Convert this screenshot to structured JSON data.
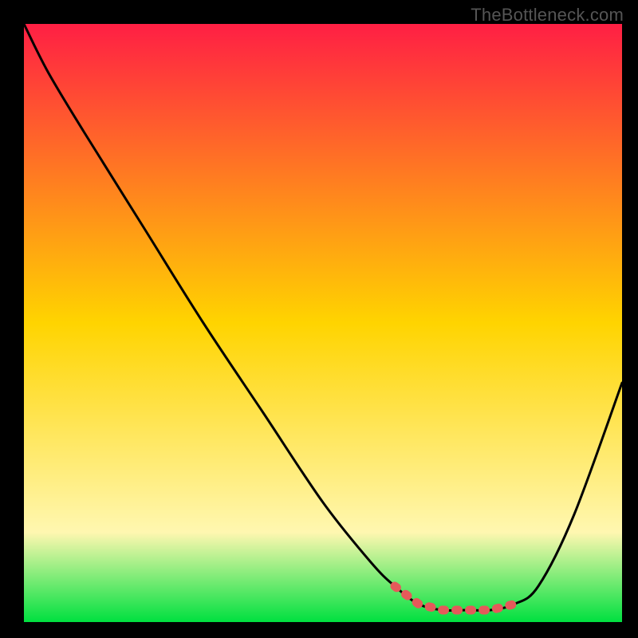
{
  "watermark": "TheBottleneck.com",
  "colors": {
    "grad_top": "#ff1f44",
    "grad_mid": "#ffd400",
    "grad_low": "#fff7b0",
    "grad_bottom": "#00e040",
    "curve": "#000000",
    "marker": "#e55a5a",
    "frame": "#000000"
  },
  "chart_data": {
    "type": "line",
    "title": "",
    "xlabel": "",
    "ylabel": "",
    "xlim": [
      0,
      100
    ],
    "ylim": [
      0,
      100
    ],
    "series": [
      {
        "name": "bottleneck-curve",
        "x": [
          0,
          4,
          10,
          20,
          30,
          40,
          50,
          58,
          62,
          66,
          70,
          74,
          78,
          82,
          86,
          92,
          100
        ],
        "values": [
          100,
          92,
          82,
          66,
          50,
          35,
          20,
          10,
          6,
          3,
          2,
          2,
          2,
          3,
          6,
          18,
          40
        ]
      }
    ],
    "markers": {
      "name": "highlight-segment",
      "x": [
        62,
        66,
        70,
        74,
        78,
        82
      ],
      "values": [
        6,
        3,
        2,
        2,
        2,
        3
      ]
    }
  }
}
